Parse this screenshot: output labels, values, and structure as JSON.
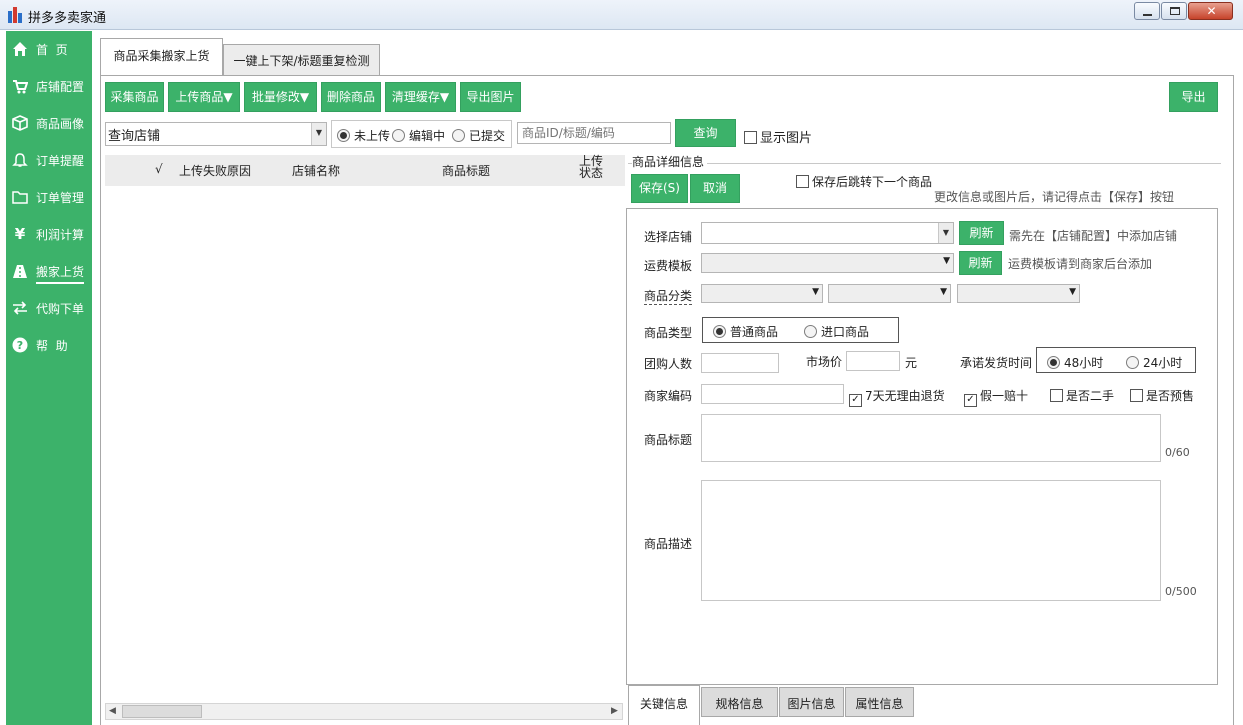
{
  "window": {
    "title": "拼多多卖家通"
  },
  "sidebar": {
    "items": [
      {
        "label": "首  页",
        "icon": "home-icon"
      },
      {
        "label": "店铺配置",
        "icon": "cart-icon"
      },
      {
        "label": "商品画像",
        "icon": "box-icon"
      },
      {
        "label": "订单提醒",
        "icon": "bell-icon"
      },
      {
        "label": "订单管理",
        "icon": "folder-icon"
      },
      {
        "label": "利润计算",
        "icon": "yen-icon"
      },
      {
        "label": "搬家上货",
        "icon": "road-icon"
      },
      {
        "label": "代购下单",
        "icon": "exchange-icon"
      },
      {
        "label": "帮  助",
        "icon": "question-icon"
      }
    ],
    "active": "搬家上货"
  },
  "tabs": [
    "商品采集搬家上货",
    "一键上下架/标题重复检测"
  ],
  "toolbar": {
    "collect": "采集商品",
    "upload": "上传商品▼",
    "batch_edit": "批量修改▼",
    "delete": "删除商品",
    "clear_cache": "清理缓存▼",
    "export_images": "导出图片",
    "export": "导出"
  },
  "filter": {
    "shop_select": "查询店铺",
    "status_options": [
      "未上传",
      "编辑中",
      "已提交"
    ],
    "status_selected": "未上传",
    "search_placeholder": "商品ID/标题/编码",
    "query": "查询",
    "show_images": "显示图片"
  },
  "grid": {
    "columns": [
      "√",
      "上传失败原因",
      "店铺名称",
      "商品标题",
      "上传状态"
    ]
  },
  "detail": {
    "title": "商品详细信息",
    "save": "保存(S)",
    "cancel": "取消",
    "save_next": "保存后跳转下一个商品",
    "hint": "更改信息或图片后，请记得点击【保存】按钮",
    "select_shop": "选择店铺",
    "refresh": "刷新",
    "shop_hint": "需先在【店铺配置】中添加店铺",
    "freight_template": "运费模板",
    "freight_hint": "运费模板请到商家后台添加",
    "category": "商品分类",
    "type_label": "商品类型",
    "type_options": [
      "普通商品",
      "进口商品"
    ],
    "type_selected": "普通商品",
    "group_count": "团购人数",
    "market_price": "市场价",
    "yuan": "元",
    "ship_time": "承诺发货时间",
    "ship_options": [
      "48小时",
      "24小时"
    ],
    "ship_selected": "48小时",
    "merchant_code": "商家编码",
    "checks": [
      {
        "label": "7天无理由退货",
        "checked": true
      },
      {
        "label": "假一赔十",
        "checked": true
      },
      {
        "label": "是否二手",
        "checked": false
      },
      {
        "label": "是否预售",
        "checked": false
      }
    ],
    "product_title": "商品标题",
    "title_count": "0/60",
    "product_desc": "商品描述",
    "desc_count": "0/500"
  },
  "bottom_tabs": [
    "关键信息",
    "规格信息",
    "图片信息",
    "属性信息"
  ],
  "colors": {
    "accent": "#3cb26a",
    "title_bar": "#dde7f3"
  }
}
